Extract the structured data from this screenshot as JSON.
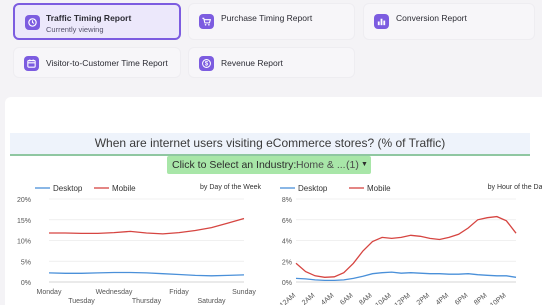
{
  "reports": [
    {
      "label": "Traffic Timing Report",
      "sub": "Currently viewing"
    },
    {
      "label": "Purchase Timing Report"
    },
    {
      "label": "Conversion Report"
    },
    {
      "label": "Visitor-to-Customer Time Report"
    },
    {
      "label": "Revenue Report"
    }
  ],
  "headline": "When are internet users visiting eCommerce stores? (% of Traffic)",
  "industry_select": {
    "label": "Click to Select an Industry:",
    "value": "Home & ...",
    "count": "(1)"
  },
  "colors": {
    "accent": "#7c5ce0",
    "desktop": "#4a90d9",
    "mobile": "#d64541",
    "select": "#a8e6a8"
  },
  "chart_data": [
    {
      "type": "line",
      "title": "by Day of the Week",
      "x_ticks": [
        "Monday",
        "Tuesday",
        "Wednesday",
        "Thursday",
        "Friday",
        "Saturday",
        "Sunday"
      ],
      "y_ticks": [
        "20%",
        "15%",
        "10%",
        "5%",
        "0%"
      ],
      "ylim": [
        0,
        20
      ],
      "legend": "top-left",
      "series": [
        {
          "name": "Desktop",
          "x": [
            0,
            0.5,
            1,
            1.5,
            2,
            2.5,
            3,
            3.5,
            4,
            4.5,
            5,
            5.5,
            6
          ],
          "values": [
            2.2,
            2.1,
            2.1,
            2.2,
            2.3,
            2.3,
            2.2,
            2.0,
            1.8,
            1.6,
            1.5,
            1.6,
            1.7
          ]
        },
        {
          "name": "Mobile",
          "x": [
            0,
            0.5,
            1,
            1.5,
            2,
            2.5,
            3,
            3.5,
            4,
            4.5,
            5,
            5.5,
            6
          ],
          "values": [
            11.8,
            11.8,
            11.7,
            11.7,
            11.9,
            12.2,
            11.8,
            11.6,
            11.9,
            12.4,
            13.1,
            14.2,
            15.3
          ]
        }
      ]
    },
    {
      "type": "line",
      "title": "by Hour of the Day",
      "x_ticks": [
        "12AM",
        "2AM",
        "4AM",
        "6AM",
        "8AM",
        "10AM",
        "12PM",
        "2PM",
        "4PM",
        "6PM",
        "8PM",
        "10PM"
      ],
      "y_ticks": [
        "8%",
        "6%",
        "4%",
        "2%",
        "0%"
      ],
      "ylim": [
        0,
        8
      ],
      "legend": "top-left",
      "series": [
        {
          "name": "Desktop",
          "x": [
            0,
            1,
            2,
            3,
            4,
            5,
            6,
            7,
            8,
            9,
            10,
            11,
            12,
            13,
            14,
            15,
            16,
            17,
            18,
            19,
            20,
            21,
            22,
            23
          ],
          "values": [
            0.35,
            0.3,
            0.2,
            0.15,
            0.15,
            0.2,
            0.35,
            0.55,
            0.8,
            0.9,
            0.95,
            0.85,
            0.9,
            0.85,
            0.8,
            0.8,
            0.75,
            0.75,
            0.8,
            0.7,
            0.65,
            0.6,
            0.6,
            0.45
          ]
        },
        {
          "name": "Mobile",
          "x": [
            0,
            1,
            2,
            3,
            4,
            5,
            6,
            7,
            8,
            9,
            10,
            11,
            12,
            13,
            14,
            15,
            16,
            17,
            18,
            19,
            20,
            21,
            22,
            23
          ],
          "values": [
            1.8,
            1.0,
            0.6,
            0.45,
            0.5,
            0.9,
            1.8,
            3.0,
            3.9,
            4.3,
            4.2,
            4.3,
            4.5,
            4.4,
            4.2,
            4.1,
            4.3,
            4.6,
            5.2,
            6.0,
            6.2,
            6.3,
            5.9,
            4.7
          ]
        }
      ]
    }
  ]
}
